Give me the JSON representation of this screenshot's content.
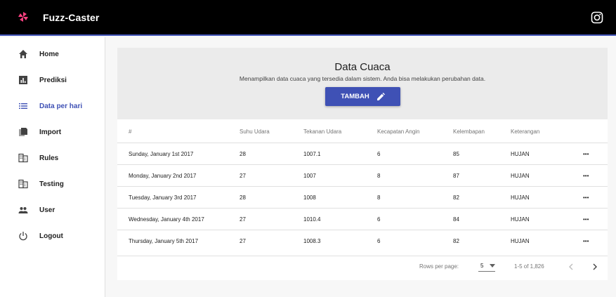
{
  "app": {
    "title": "Fuzz-Caster",
    "brand_color": "#3f51b5",
    "logo_color": "#ff4081"
  },
  "header": {
    "social_icon": "instagram-icon"
  },
  "sidebar": {
    "items": [
      {
        "label": "Home",
        "icon": "home-icon",
        "active": false
      },
      {
        "label": "Prediksi",
        "icon": "chart-icon",
        "active": false
      },
      {
        "label": "Data per hari",
        "icon": "list-icon",
        "active": true
      },
      {
        "label": "Import",
        "icon": "import-icon",
        "active": false
      },
      {
        "label": "Rules",
        "icon": "rules-icon",
        "active": false
      },
      {
        "label": "Testing",
        "icon": "testing-icon",
        "active": false
      },
      {
        "label": "User",
        "icon": "user-icon",
        "active": false
      },
      {
        "label": "Logout",
        "icon": "power-icon",
        "active": false
      }
    ]
  },
  "page": {
    "title": "Data Cuaca",
    "subtitle": "Menampilkan data cuaca yang tersedia dalam sistem. Anda bisa melakukan perubahan data.",
    "add_button": "TAMBAH"
  },
  "table": {
    "columns": [
      "#",
      "Suhu Udara",
      "Tekanan Udara",
      "Kecapatan Angin",
      "Kelembapan",
      "Keterangan"
    ],
    "rows": [
      [
        "Sunday, January 1st 2017",
        "28",
        "1007.1",
        "6",
        "85",
        "HUJAN"
      ],
      [
        "Monday, January 2nd 2017",
        "27",
        "1007",
        "8",
        "87",
        "HUJAN"
      ],
      [
        "Tuesday, January 3rd 2017",
        "28",
        "1008",
        "8",
        "82",
        "HUJAN"
      ],
      [
        "Wednesday, January 4th 2017",
        "27",
        "1010.4",
        "6",
        "84",
        "HUJAN"
      ],
      [
        "Thursday, January 5th 2017",
        "27",
        "1008.3",
        "6",
        "82",
        "HUJAN"
      ]
    ],
    "row_action": "•••"
  },
  "pagination": {
    "rows_per_page_label": "Rows per page:",
    "rows_per_page": "5",
    "range": "1-5 of 1,826"
  }
}
